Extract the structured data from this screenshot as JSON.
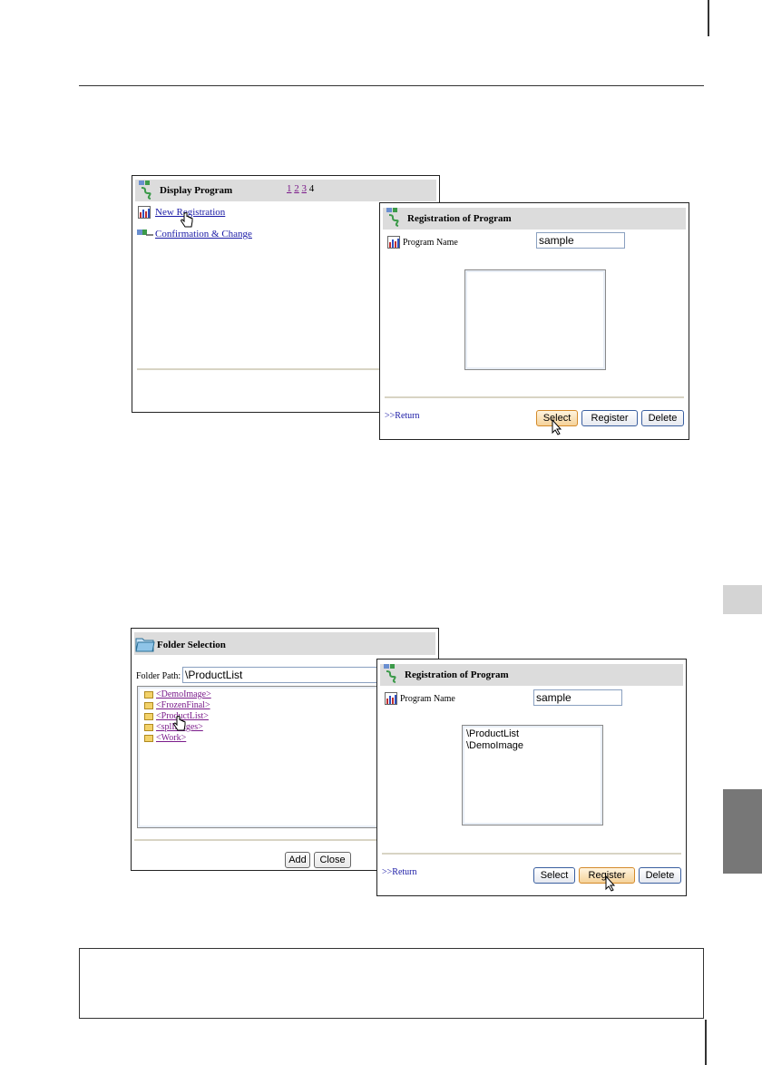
{
  "display_program": {
    "title": "Display Program",
    "pages": [
      "1",
      "2",
      "3",
      "4"
    ],
    "new_registration": "New Registration",
    "confirmation_change": "Confirmation & Change"
  },
  "registration_1": {
    "title": "Registration of Program",
    "program_name_label": "Program Name",
    "program_name_value": "sample",
    "return_link": ">>Return",
    "select_label": "Select",
    "register_label": "Register",
    "delete_label": "Delete"
  },
  "folder_selection": {
    "title": "Folder Selection",
    "folder_path_label": "Folder Path:",
    "folder_path_value": "\\ProductList",
    "folders": [
      "<DemoImage>",
      "<FrozenFinal>",
      "<ProductList>",
      "<splImages>",
      "<Work>"
    ],
    "add_label": "Add",
    "close_label": "Close"
  },
  "registration_2": {
    "title": "Registration of Program",
    "program_name_label": "Program Name",
    "program_name_value": "sample",
    "list_items": [
      "\\ProductList",
      "\\DemoImage"
    ],
    "return_link": ">>Return",
    "select_label": "Select",
    "register_label": "Register",
    "delete_label": "Delete"
  },
  "icons": [
    "program-icon",
    "graph-icon",
    "folder-icon",
    "pointer-cursor-icon",
    "hand-cursor-icon"
  ],
  "colors": {
    "titlebar": "#dcdcdc",
    "link": "#1a1aa6",
    "visited": "#7a1a8a",
    "button_hot": "#f5d29a",
    "button_border": "#3a5fa0"
  }
}
